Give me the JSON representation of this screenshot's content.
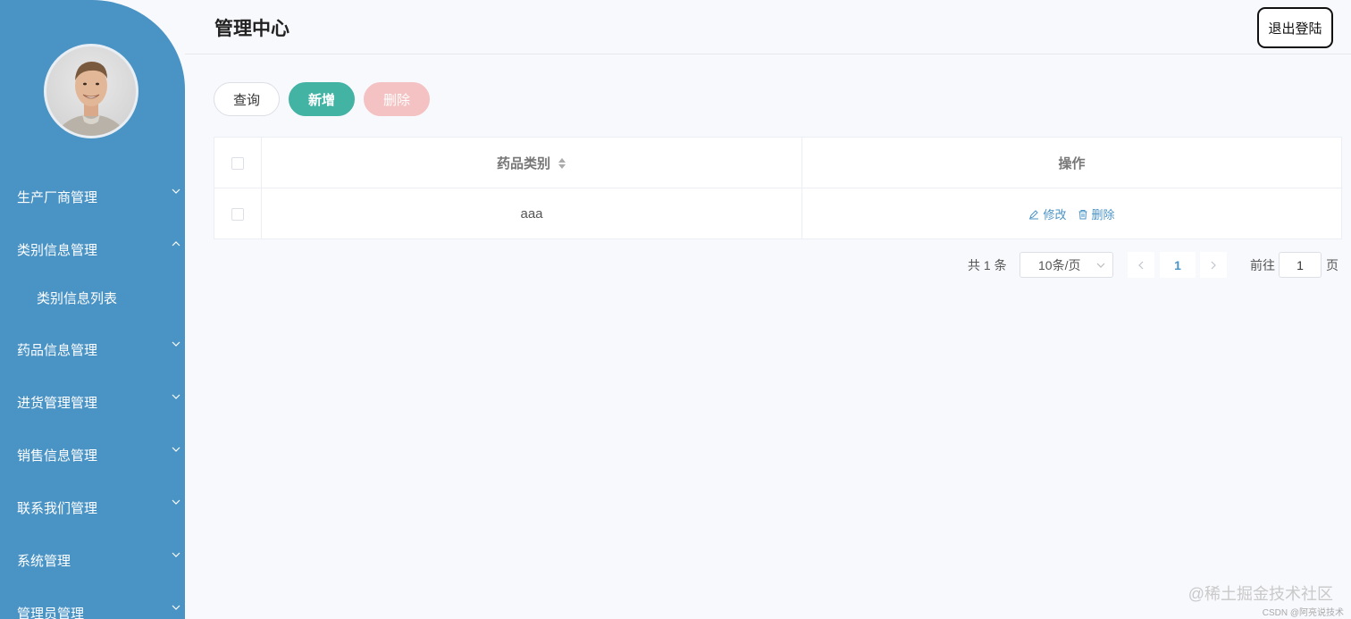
{
  "sidebar": {
    "items": [
      {
        "label": "生产厂商管理",
        "expanded": false
      },
      {
        "label": "类别信息管理",
        "expanded": true,
        "children": [
          {
            "label": "类别信息列表"
          }
        ]
      },
      {
        "label": "药品信息管理",
        "expanded": false
      },
      {
        "label": "进货管理管理",
        "expanded": false
      },
      {
        "label": "销售信息管理",
        "expanded": false
      },
      {
        "label": "联系我们管理",
        "expanded": false
      },
      {
        "label": "系统管理",
        "expanded": false
      },
      {
        "label": "管理员管理",
        "expanded": false
      }
    ],
    "bg_color": "#4a93c5"
  },
  "header": {
    "title": "管理中心",
    "logout_label": "退出登陆"
  },
  "toolbar": {
    "query_label": "查询",
    "add_label": "新增",
    "delete_label": "删除",
    "add_color": "#43b3a4",
    "delete_color": "#f4c2c2"
  },
  "table": {
    "columns": [
      "药品类别",
      "操作"
    ],
    "rows": [
      {
        "category": "aaa",
        "actions": [
          "修改",
          "删除"
        ]
      }
    ]
  },
  "pagination": {
    "total_text": "共 1 条",
    "page_size": "10条/页",
    "current_page": "1",
    "goto_label": "前往",
    "goto_value": "1",
    "page_unit": "页"
  },
  "watermark": {
    "main": "@稀土掘金技术社区",
    "sub": "CSDN @阿亮说技术"
  }
}
